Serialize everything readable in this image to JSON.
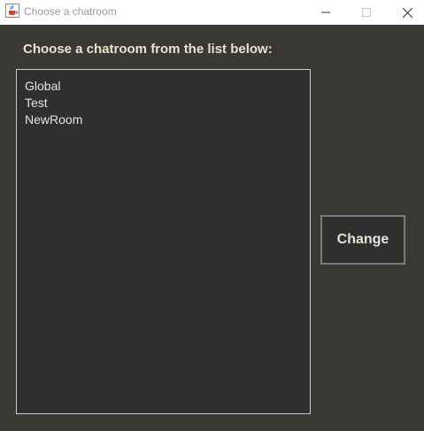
{
  "window": {
    "title": "Choose a chatroom"
  },
  "heading": "Choose a chatroom from the list below:",
  "chatrooms": [
    "Global",
    "Test",
    "NewRoom"
  ],
  "change_button": "Change",
  "icons": {
    "app": "java-cup-icon",
    "minimize": "minimize-icon",
    "maximize": "maximize-icon",
    "close": "close-icon"
  },
  "colors": {
    "background": "#3a3832",
    "list_background": "#2f2f2f",
    "text": "#e8e2d4"
  }
}
